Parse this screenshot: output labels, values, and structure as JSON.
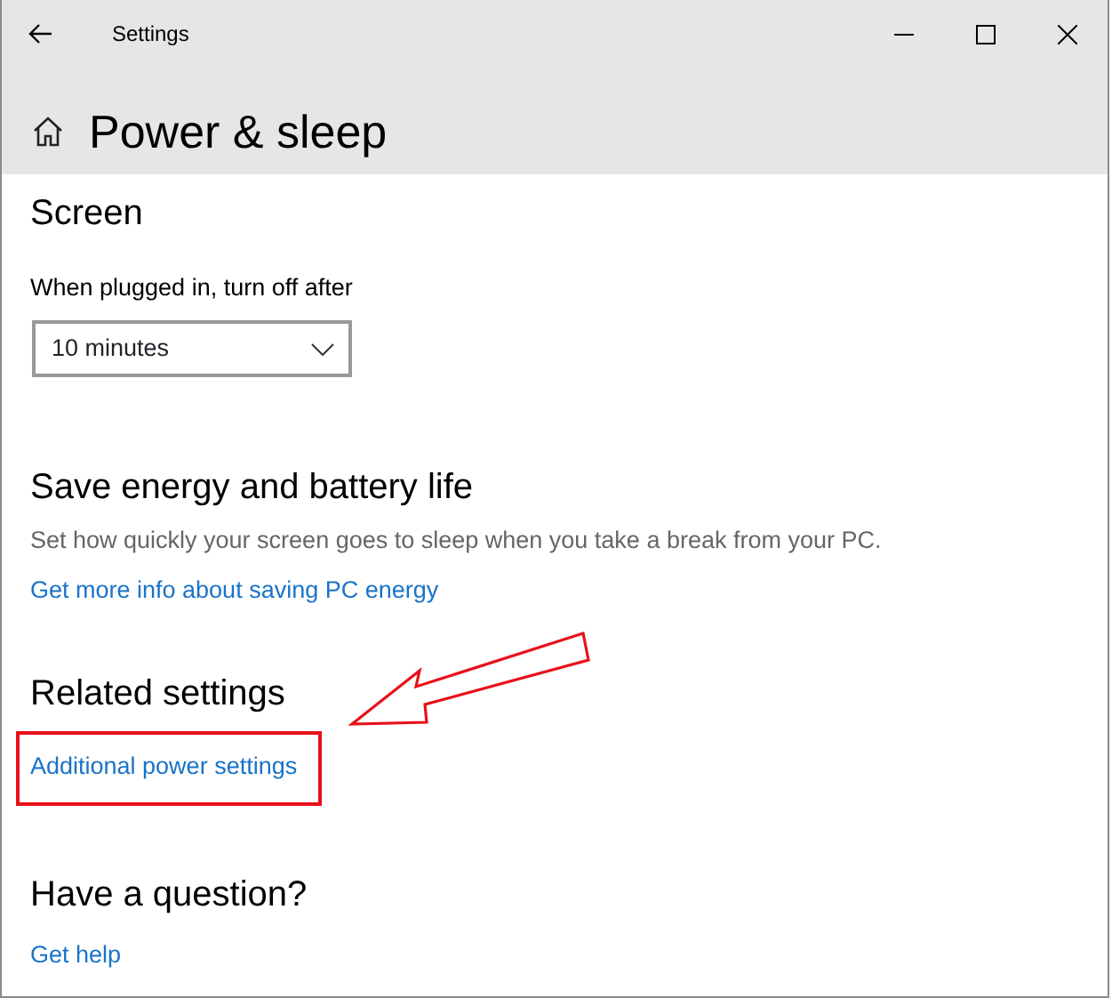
{
  "window": {
    "title": "Settings"
  },
  "page": {
    "title": "Power & sleep"
  },
  "sections": [
    {
      "kind": "dropdown",
      "heading": "Screen",
      "label": "When plugged in, turn off after",
      "value": "10 minutes"
    },
    {
      "kind": "info",
      "heading": "Save energy and battery life",
      "description": "Set how quickly your screen goes to sleep when you take a break from your PC.",
      "link": {
        "text": "Get more info about saving PC energy",
        "highlighted": false
      }
    },
    {
      "kind": "links",
      "heading": "Related settings",
      "link": {
        "text": "Additional power settings",
        "highlighted": true
      }
    },
    {
      "kind": "links",
      "heading": "Have a question?",
      "link": {
        "text": "Get help",
        "highlighted": false
      }
    }
  ]
}
